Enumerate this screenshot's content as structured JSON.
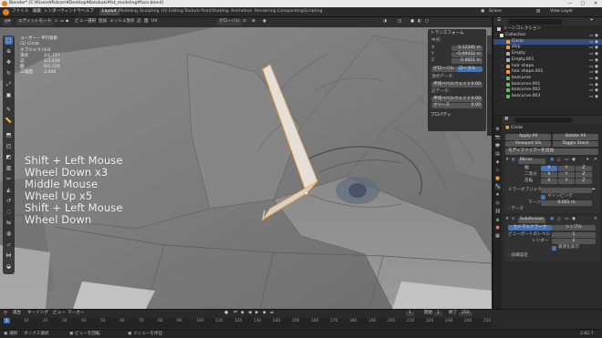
{
  "app": {
    "window_title": "Blender* [C:¥Users¥Rdcom¥Desktop¥Kotobuki¥fot_modeling¥face.blend]",
    "window_controls": [
      "—",
      "□",
      "✕"
    ]
  },
  "menu": [
    "ファイル",
    "編集",
    "レンダー",
    "ウィンドウ",
    "ヘルプ"
  ],
  "workspaces": [
    "Layout",
    "Modeling",
    "Sculpting",
    "UV Editing",
    "Texture Paint",
    "Shading",
    "Animation",
    "Rendering",
    "Compositing",
    "Scripting"
  ],
  "active_workspace": "Layout",
  "top_right": {
    "scene": "Scene",
    "view_layer": "View Layer"
  },
  "viewport": {
    "header": {
      "mode": "エディットモード",
      "view_items": [
        "ビュー",
        "選択",
        "追加",
        "メッシュ",
        "頂点",
        "辺",
        "面",
        "UV"
      ],
      "transform_orientation": "グローバル"
    },
    "stats": {
      "title": "ユーザー・平行投影",
      "object": "(1) Circle",
      "rows": [
        {
          "label": "オブジェクト",
          "value": "1/4"
        },
        {
          "label": "頂点",
          "value": "2/1,777"
        },
        {
          "label": "辺",
          "value": "1/3,430"
        },
        {
          "label": "面",
          "value": "0/1,720"
        },
        {
          "label": "三角面",
          "value": "3,446"
        }
      ]
    },
    "key_overlay": [
      "Shift + Left Mouse",
      "Wheel Down x3",
      "Middle Mouse",
      "Wheel Up x5",
      "Shift + Left Mouse",
      "Wheel Down"
    ],
    "n_panel": {
      "transform_header": "トランスフォーム",
      "median_label": "中点:",
      "fields": [
        {
          "label": "X",
          "value": "0.12345 m"
        },
        {
          "label": "Y",
          "value": "-0.09432 m"
        },
        {
          "label": "Z",
          "value": "0.4821 m"
        }
      ],
      "toggle": [
        "グローバル",
        "ローカル"
      ],
      "vertex_data_header": "頂点データ:",
      "vertex_fields": [
        {
          "label": "平均ベベルウェイト",
          "value": "0.00"
        }
      ],
      "edge_data_header": "辺データ:",
      "edge_fields": [
        {
          "label": "平均ベベルウェイト",
          "value": "0.00"
        },
        {
          "label": "クリース",
          "value": "0.00"
        }
      ],
      "properties_header": "プロパティ"
    },
    "side_tabs": [
      "アイテム",
      "ツール",
      "ビュー",
      "編集"
    ]
  },
  "outliner": {
    "header": "シーンコレクション",
    "items": [
      {
        "name": "Collection",
        "color": "#e0e0e0",
        "indent": 0
      },
      {
        "name": "Circle",
        "color": "#f0a040",
        "indent": 1,
        "selected": true
      },
      {
        "name": "ship",
        "color": "#f0a040",
        "indent": 1
      },
      {
        "name": "Empty",
        "color": "#b0b0b0",
        "indent": 1
      },
      {
        "name": "Empty.001",
        "color": "#b0b0b0",
        "indent": 1
      },
      {
        "name": "hair shape",
        "color": "#f0a040",
        "indent": 1
      },
      {
        "name": "hair shape.001",
        "color": "#f0a040",
        "indent": 1
      },
      {
        "name": "bezcurve",
        "color": "#60c060",
        "indent": 1
      },
      {
        "name": "bezcurve.001",
        "color": "#60c060",
        "indent": 1
      },
      {
        "name": "bezcurve.002",
        "color": "#60c060",
        "indent": 1
      },
      {
        "name": "bezcurve.003",
        "color": "#60c060",
        "indent": 1
      }
    ]
  },
  "properties": {
    "object_name": "Circle",
    "buttons_row1": [
      "Apply All",
      "Delete All"
    ],
    "buttons_row2": [
      "Viewport Vis",
      "Toggle Stack"
    ],
    "add_modifier": "モディファイアーを追加",
    "mirror": {
      "name": "Mirror",
      "axis_label": "軸",
      "bisect_label": "二等分",
      "flip_label": "反転",
      "axes": [
        "X",
        "Y",
        "Z"
      ],
      "mirror_object_label": "ミラーオブジェクト",
      "clipping_label": "クリッピング",
      "merge_label": "マージ",
      "merge_value": "0.001 m",
      "data_label": "データ"
    },
    "subdivision": {
      "name": "Subdivision",
      "mode_a": "カトマルクラーク",
      "mode_b": "シンプル",
      "levels_viewport_label": "ビューポートのレベル",
      "levels_viewport": "1",
      "render_label": "レンダー",
      "render": "2",
      "optimal_label": "最適化表示",
      "advanced_label": "詳細設定"
    }
  },
  "timeline": {
    "menu": [
      "再生",
      "キーイング",
      "ビュー",
      "マーカー"
    ],
    "current_frame": "1",
    "start_label": "開始",
    "start": "1",
    "end_label": "終了",
    "end": "250",
    "ticks": [
      "0",
      "10",
      "20",
      "30",
      "40",
      "50",
      "60",
      "70",
      "80",
      "90",
      "100",
      "110",
      "120",
      "130",
      "140",
      "150",
      "160",
      "170",
      "180",
      "190",
      "200",
      "210",
      "220",
      "230",
      "240",
      "250"
    ]
  },
  "statusbar": {
    "items": [
      "選択",
      "ボックス選択",
      "ビューを回転",
      "メニューを呼出"
    ],
    "version": "2.82.7"
  }
}
